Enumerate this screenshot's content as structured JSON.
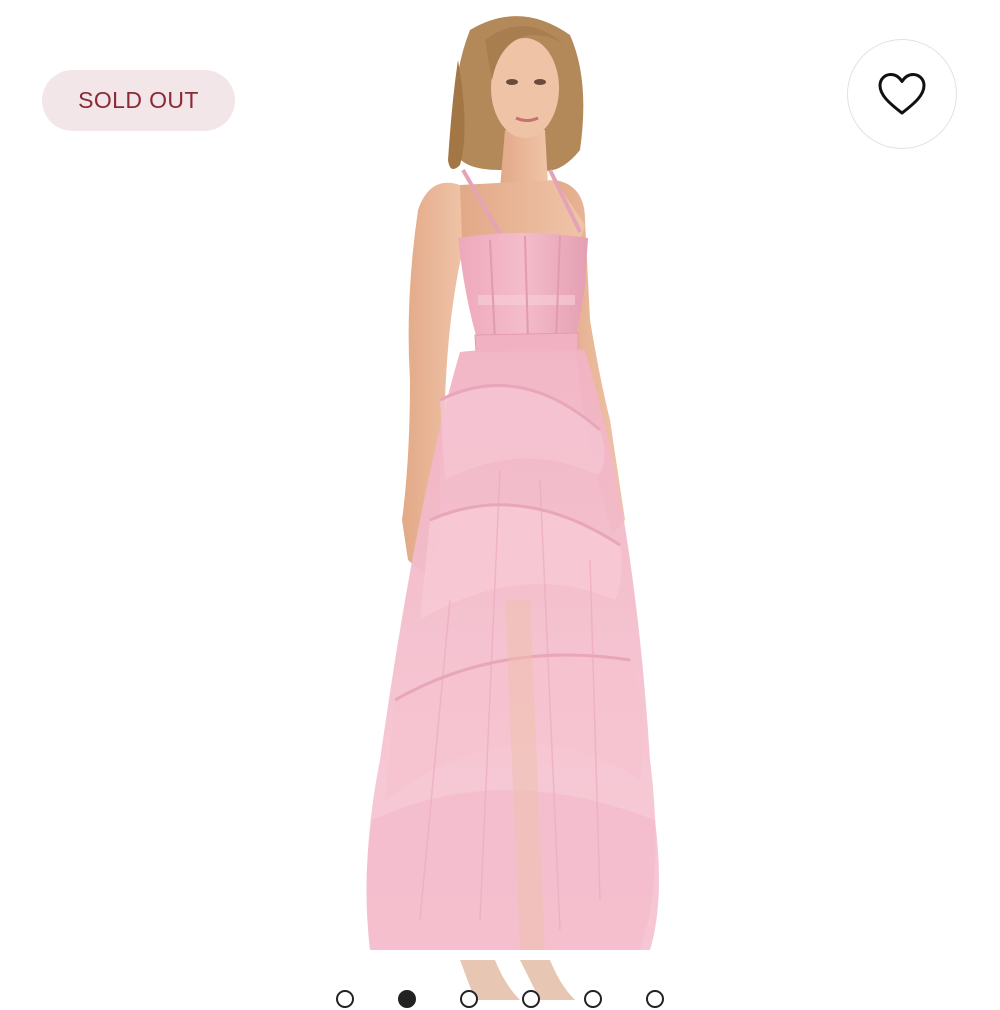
{
  "badge": {
    "label": "SOLD OUT"
  },
  "favorite": {
    "icon": "heart-outline-icon"
  },
  "gallery": {
    "image_count": 6,
    "active_index": 1
  },
  "colors": {
    "badge_bg": "#f3e6e8",
    "badge_text": "#8a2a36",
    "dress_pink": "#f2b6c6",
    "skin": "#e9b89a",
    "hair": "#b48a5c"
  }
}
